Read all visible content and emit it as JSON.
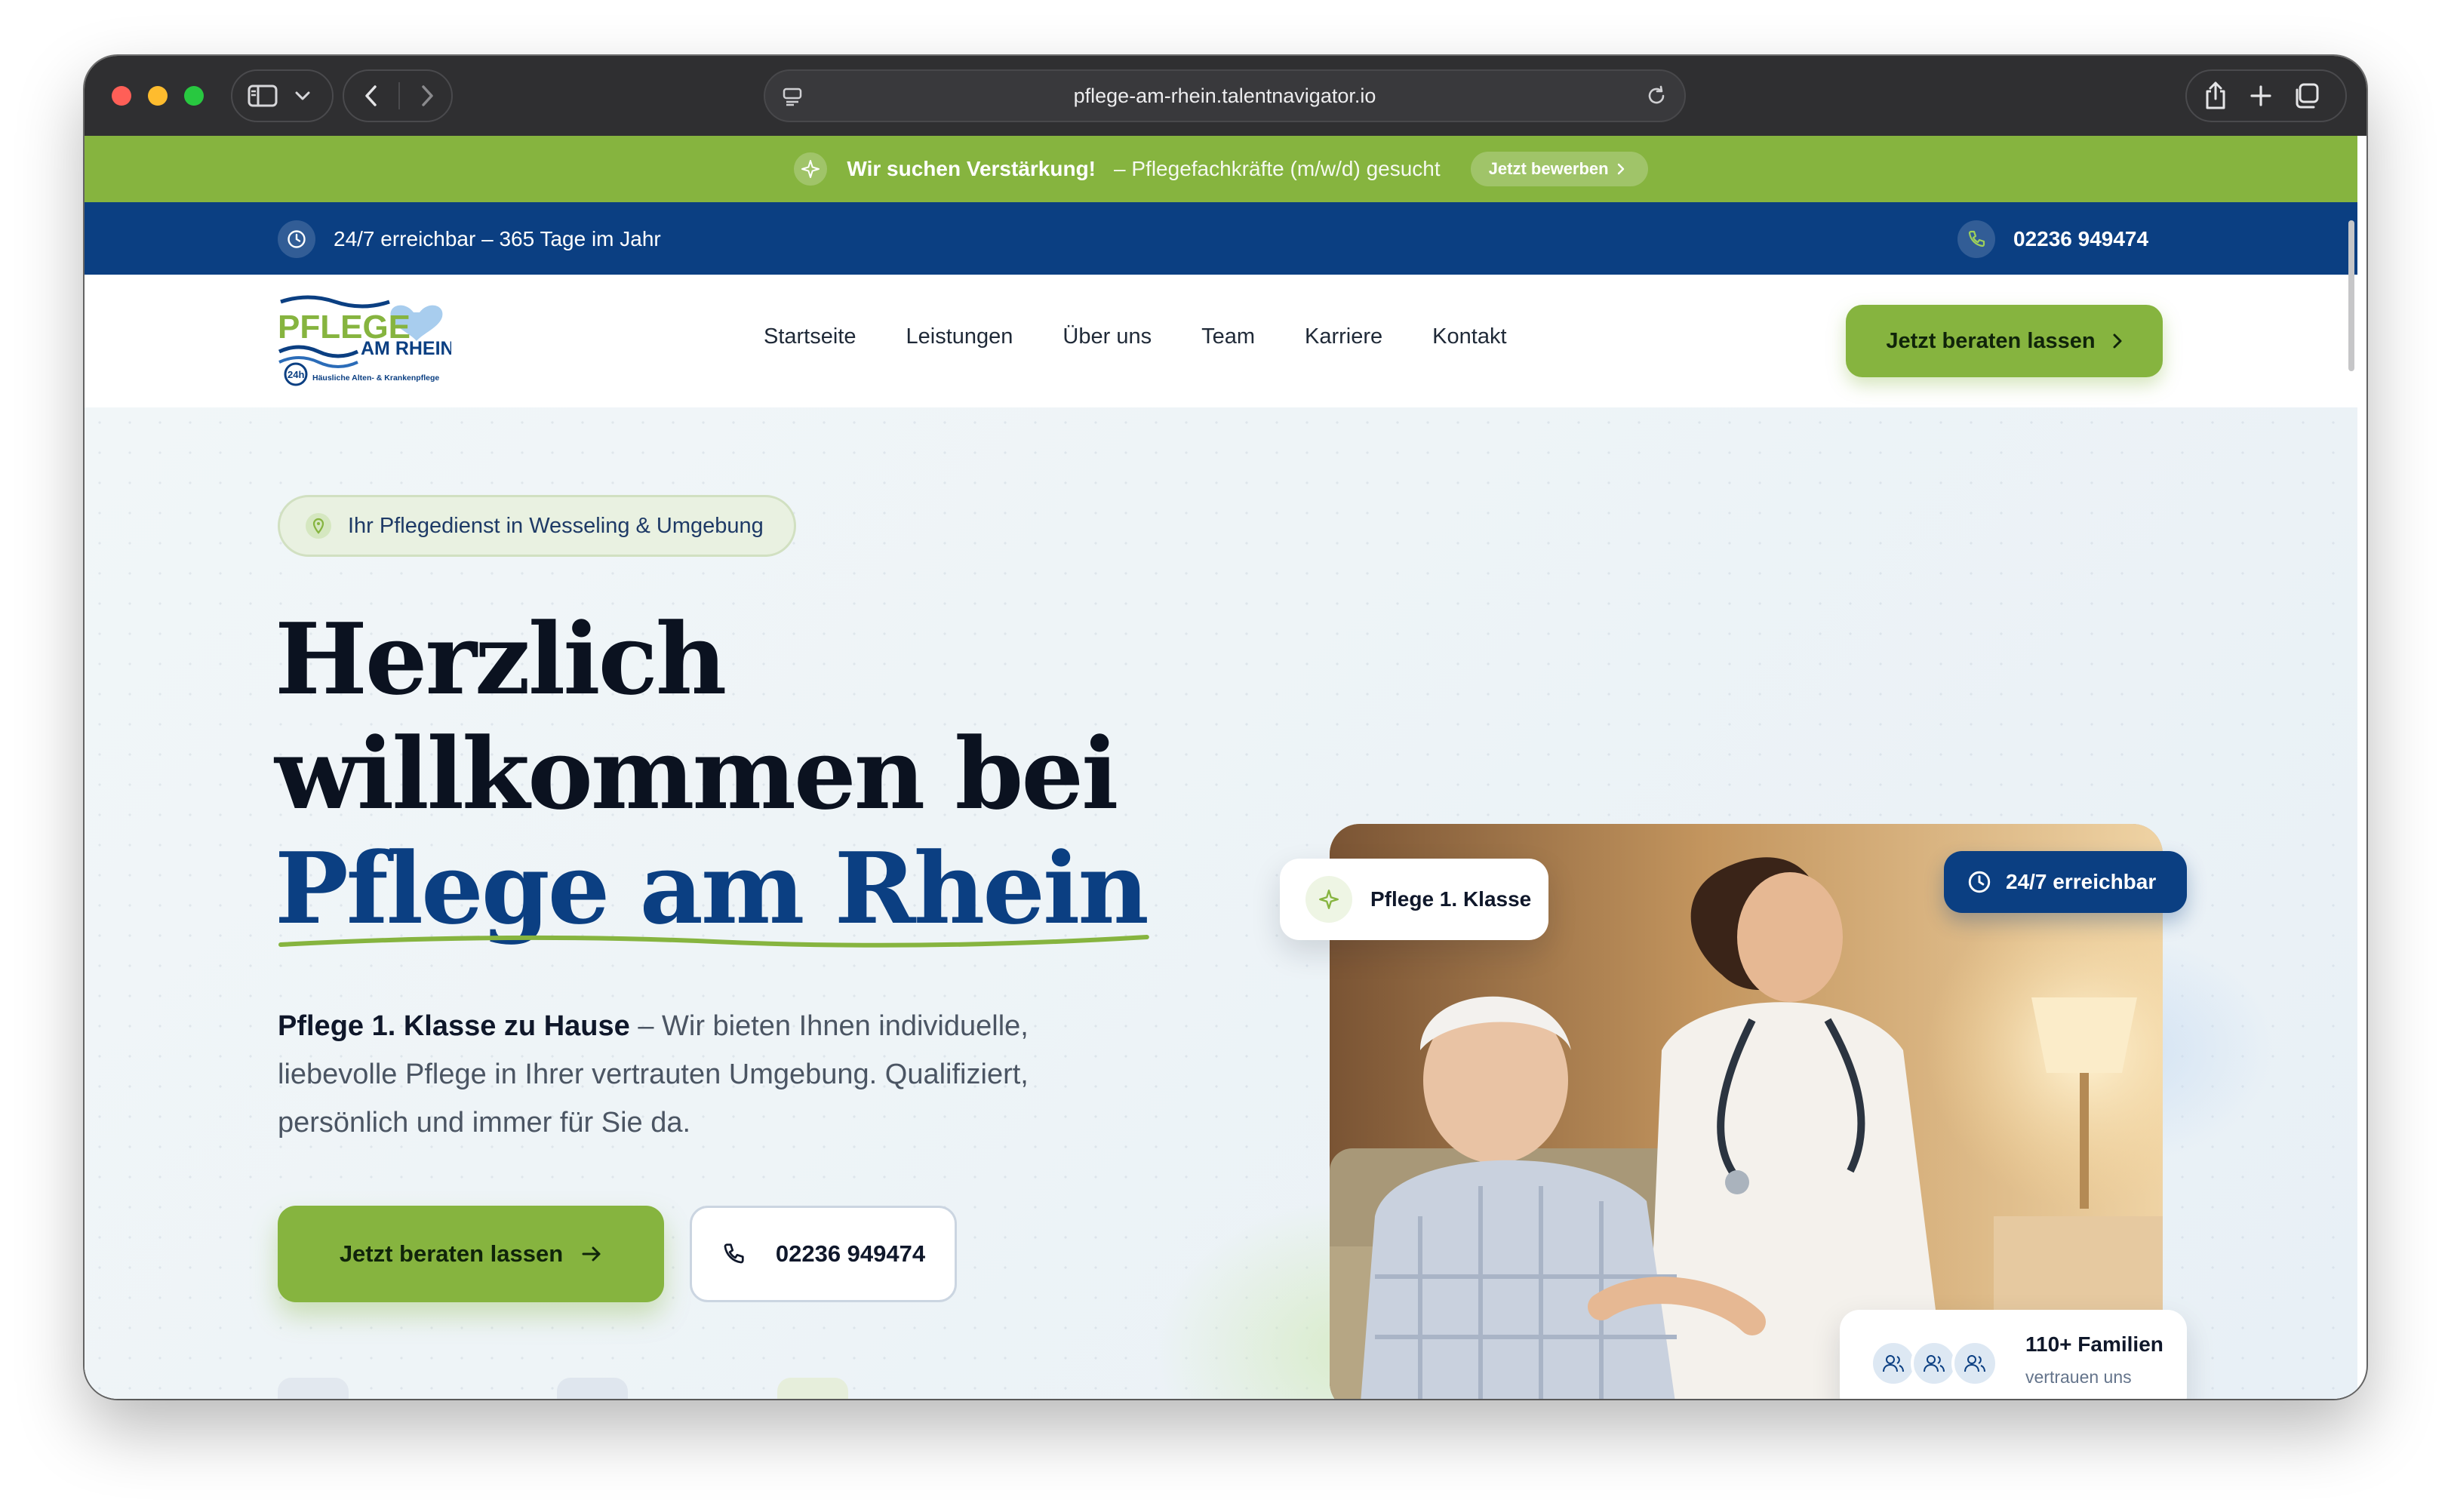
{
  "browser": {
    "url": "pflege-am-rhein.talentnavigator.io"
  },
  "promo": {
    "headline": "Wir suchen Verstärkung!",
    "text": "– Pflegefachkräfte (m/w/d) gesucht",
    "cta": "Jetzt bewerben"
  },
  "infobar": {
    "availability": "24/7 erreichbar – 365 Tage im Jahr",
    "phone": "02236 949474"
  },
  "logo": {
    "word1": "PFLEGE",
    "word2": "AM RHEIN",
    "badge": "24h",
    "tagline": "Häusliche Alten- & Krankenpflege"
  },
  "nav": {
    "items": [
      "Startseite",
      "Leistungen",
      "Über uns",
      "Team",
      "Karriere",
      "Kontakt"
    ],
    "cta": "Jetzt beraten lassen"
  },
  "hero": {
    "pill": "Ihr Pflegedienst in Wesseling & Umgebung",
    "title_line1": "Herzlich",
    "title_line2": "willkommen bei",
    "title_line3": "Pflege am Rhein",
    "lead_strong": "Pflege 1. Klasse zu Hause",
    "lead_rest": " – Wir bieten Ihnen individuelle, liebevolle Pflege in Ihrer vertrauten Umgebung. Qualifiziert, persönlich und immer für Sie da.",
    "primary_cta": "Jetzt beraten lassen",
    "phone_cta": "02236 949474"
  },
  "badges": {
    "quality": "Pflege 1. Klasse",
    "availability": "24/7 erreichbar",
    "families_count": "110+ Familien",
    "families_text": "vertrauen uns"
  },
  "colors": {
    "green": "#86b43f",
    "navy": "#0b3f82"
  }
}
